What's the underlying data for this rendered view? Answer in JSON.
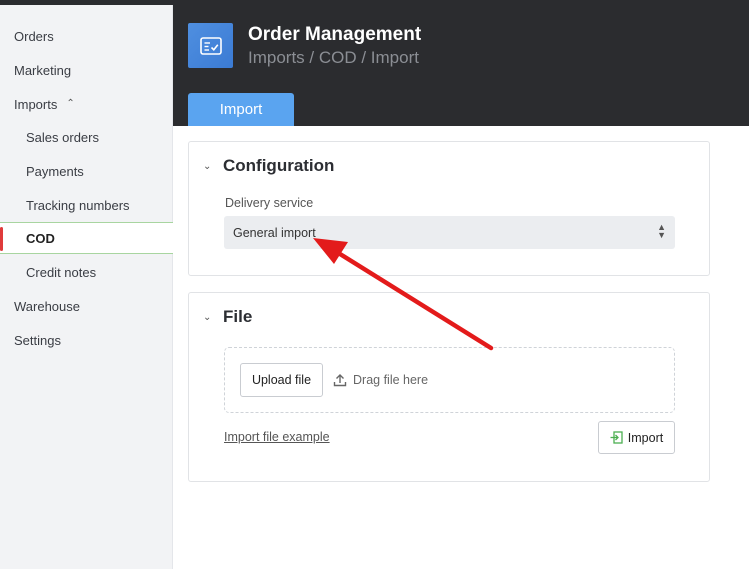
{
  "sidebar": {
    "items": [
      {
        "label": "Orders"
      },
      {
        "label": "Marketing"
      },
      {
        "label": "Imports"
      },
      {
        "label": "Sales orders"
      },
      {
        "label": "Payments"
      },
      {
        "label": "Tracking numbers"
      },
      {
        "label": "COD"
      },
      {
        "label": "Credit notes"
      },
      {
        "label": "Warehouse"
      },
      {
        "label": "Settings"
      }
    ],
    "active": "COD"
  },
  "header": {
    "title": "Order Management",
    "breadcrumb": "Imports / COD / Import",
    "tab": "Import"
  },
  "configuration": {
    "title": "Configuration",
    "field_label": "Delivery service",
    "selected_value": "General import"
  },
  "file": {
    "title": "File",
    "upload_label": "Upload file",
    "drag_hint": "Drag file here",
    "example_link": "Import file example",
    "import_label": "Import"
  },
  "colors": {
    "accent": "#5aa4f0",
    "header_bg": "#2b2c2f",
    "annotation_arrow": "#e31b1b",
    "active_border": "#a8d5a0"
  }
}
